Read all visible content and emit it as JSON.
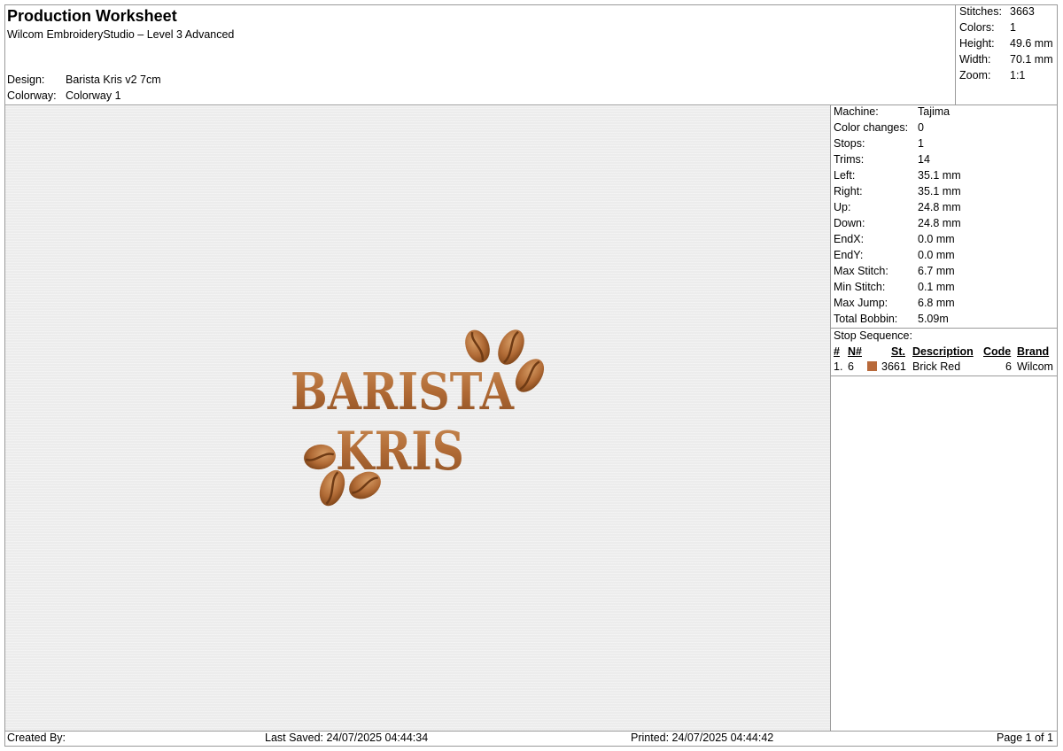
{
  "header": {
    "title": "Production Worksheet",
    "subtitle": "Wilcom EmbroideryStudio – Level 3 Advanced",
    "design_label": "Design:",
    "design_value": "Barista Kris v2 7cm",
    "colorway_label": "Colorway:",
    "colorway_value": "Colorway 1"
  },
  "summary": [
    {
      "label": "Stitches:",
      "value": "3663"
    },
    {
      "label": "Colors:",
      "value": "1"
    },
    {
      "label": "Height:",
      "value": "49.6 mm"
    },
    {
      "label": "Width:",
      "value": "70.1 mm"
    },
    {
      "label": "Zoom:",
      "value": "1:1"
    }
  ],
  "machine_info": [
    {
      "label": "Machine:",
      "value": "Tajima"
    },
    {
      "label": "Color changes:",
      "value": "0"
    },
    {
      "label": "Stops:",
      "value": "1"
    },
    {
      "label": "Trims:",
      "value": "14"
    },
    {
      "label": "Left:",
      "value": "35.1 mm"
    },
    {
      "label": "Right:",
      "value": "35.1 mm"
    },
    {
      "label": "Up:",
      "value": "24.8 mm"
    },
    {
      "label": "Down:",
      "value": "24.8 mm"
    },
    {
      "label": "EndX:",
      "value": "0.0 mm"
    },
    {
      "label": "EndY:",
      "value": "0.0 mm"
    },
    {
      "label": "Max Stitch:",
      "value": "6.7 mm"
    },
    {
      "label": "Min Stitch:",
      "value": "0.1 mm"
    },
    {
      "label": "Max Jump:",
      "value": "6.8 mm"
    },
    {
      "label": "Total Bobbin:",
      "value": "5.09m"
    }
  ],
  "stop_sequence": {
    "label": "Stop Sequence:",
    "columns": {
      "num": "#",
      "n": "N#",
      "st": "St.",
      "description": "Description",
      "code": "Code",
      "brand": "Brand"
    },
    "rows": [
      {
        "num": "1.",
        "n": "6",
        "swatch_color": "#b8693a",
        "st": "3661",
        "description": "Brick Red",
        "code": "6",
        "brand": "Wilcom"
      }
    ]
  },
  "design": {
    "line1": "BARISTA",
    "line2": "KRIS",
    "thread_color": "#b06a35"
  },
  "footer": {
    "created_by": "Created By:",
    "last_saved": "Last Saved: 24/07/2025 04:44:34",
    "printed": "Printed: 24/07/2025 04:44:42",
    "page": "Page 1 of 1"
  }
}
